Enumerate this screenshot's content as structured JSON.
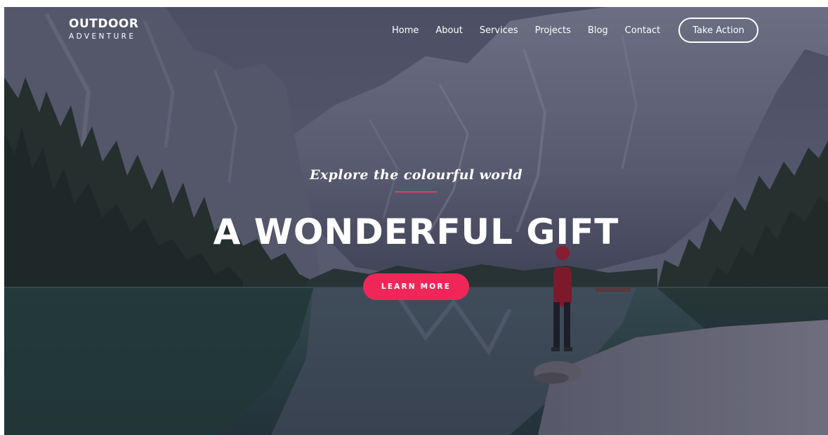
{
  "brand": {
    "name_top": "OUTDOOR",
    "name_bottom": "ADVENTURE"
  },
  "nav": {
    "items": [
      {
        "label": "Home"
      },
      {
        "label": "About"
      },
      {
        "label": "Services"
      },
      {
        "label": "Projects"
      },
      {
        "label": "Blog"
      },
      {
        "label": "Contact"
      }
    ],
    "cta_label": "Take Action"
  },
  "hero": {
    "tagline": "Explore the colourful world",
    "headline": "A WONDERFUL GIFT",
    "button_label": "LEARN MORE"
  },
  "colors": {
    "accent": "#ef2759",
    "divider": "#e8395e",
    "text": "#ffffff"
  }
}
